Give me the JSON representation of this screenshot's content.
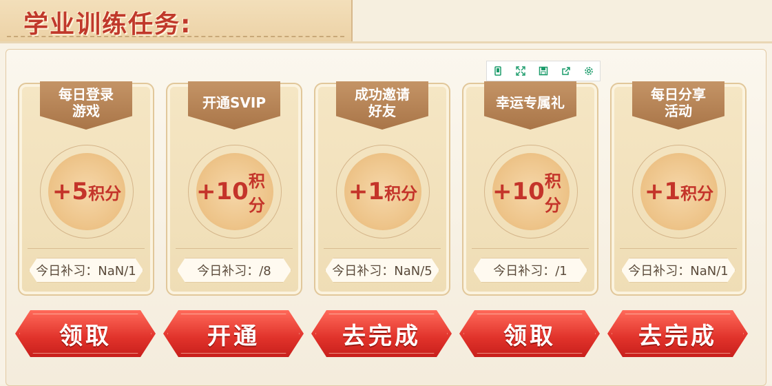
{
  "title": "学业训练任务:",
  "toolbar": {
    "icons": [
      "tablet-icon",
      "expand-icon",
      "save-icon",
      "share-icon",
      "settings-icon"
    ]
  },
  "tasks": [
    {
      "name": "每日登录游戏",
      "name_lines": [
        "每日登录",
        "游戏"
      ],
      "reward_plus": "+5",
      "reward_unit": "积分",
      "progress": "今日补习：NaN/1",
      "button": "领取"
    },
    {
      "name": "开通SVIP",
      "name_lines": [
        "开通SVIP",
        ""
      ],
      "reward_plus": "+10",
      "reward_unit": "积分",
      "progress": "今日补习：/8",
      "button": "开通"
    },
    {
      "name": "成功邀请好友",
      "name_lines": [
        "成功邀请",
        "好友"
      ],
      "reward_plus": "+1",
      "reward_unit": "积分",
      "progress": "今日补习：NaN/5",
      "button": "去完成"
    },
    {
      "name": "幸运专属礼",
      "name_lines": [
        "幸运专属礼",
        ""
      ],
      "reward_plus": "+10",
      "reward_unit": "积分",
      "progress": "今日补习：/1",
      "button": "领取"
    },
    {
      "name": "每日分享活动",
      "name_lines": [
        "每日分享",
        "活动"
      ],
      "reward_plus": "+1",
      "reward_unit": "积分",
      "progress": "今日补习：NaN/1",
      "button": "去完成"
    }
  ],
  "colors": {
    "accent_red": "#e0322a",
    "banner_brown": "#b27f51",
    "medal_gold": "#eec58b"
  }
}
